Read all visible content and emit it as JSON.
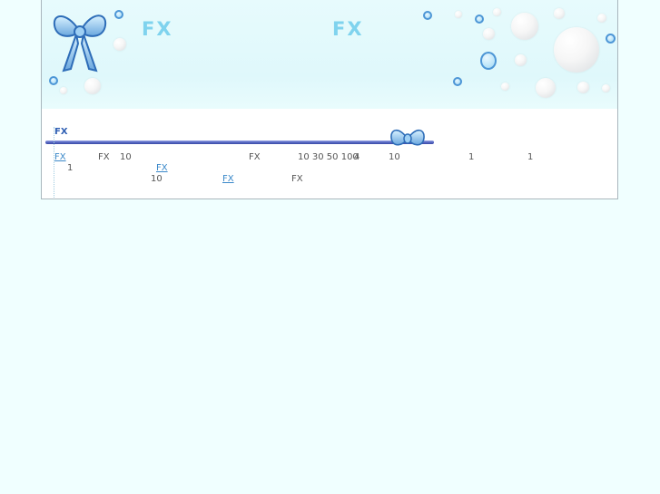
{
  "header": {
    "brand_left": "FX",
    "brand_right": "FX"
  },
  "section": {
    "title": "FX"
  },
  "text": {
    "link1": "FX",
    "t1": "FX",
    "t2": "10",
    "t3": "FX",
    "t4": "10 30 50 100",
    "t5": "4",
    "t6": "10",
    "t7": "1",
    "t8": "1",
    "t9": "1",
    "link2": "FX",
    "t10": "10",
    "link3": "FX",
    "t11": "FX"
  },
  "colors": {
    "brand": "#7fd3ee",
    "accent_line": "#5667c2",
    "link": "#3a88c9"
  },
  "icons": [
    "ribbon-bow-icon",
    "small-ribbon-bow-icon"
  ]
}
